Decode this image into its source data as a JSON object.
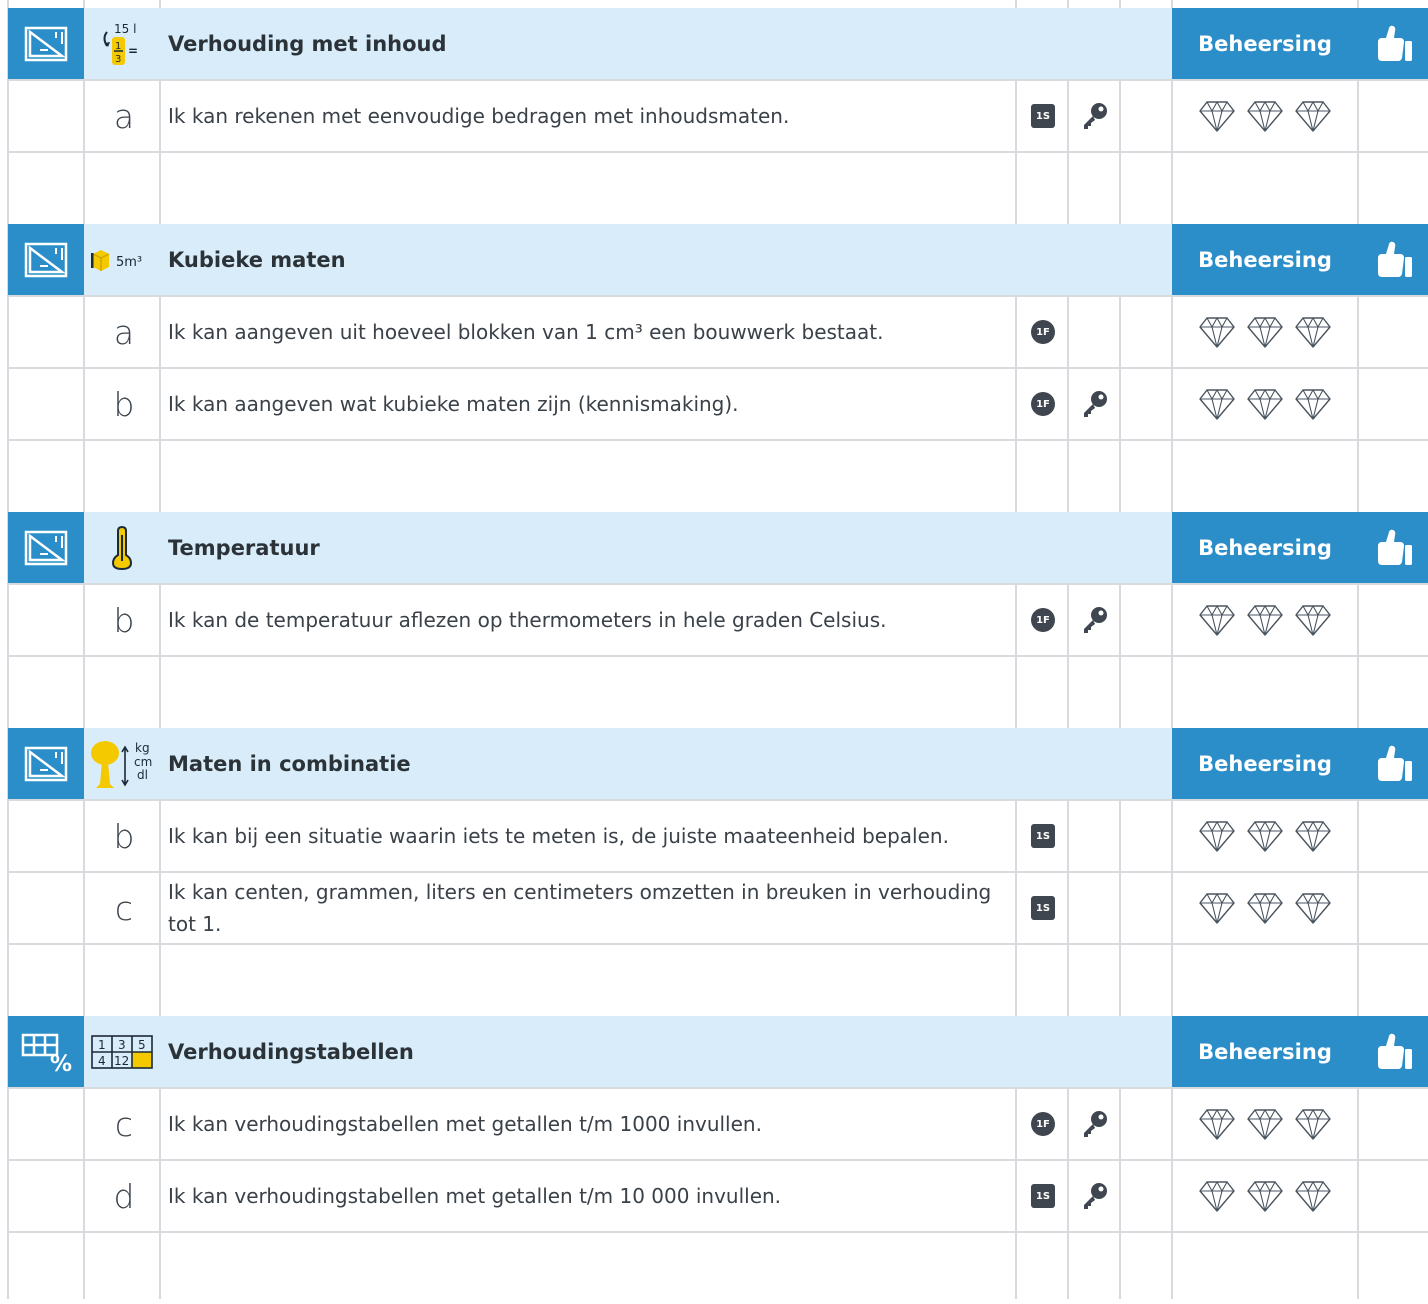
{
  "sections": [
    {
      "title": "Verhouding met inhoud",
      "domain_icon": "ruler-triangle-icon",
      "topic_icon": "fraction-volume-icon",
      "topic_icon_text": [
        "15 l",
        "1",
        "3",
        "="
      ],
      "mastery_label": "Beheersing",
      "mastery_icon": "thumbs-up-icon",
      "goals": [
        {
          "letter": "a",
          "text": "Ik kan rekenen met eenvoudige bedragen met inhoudsmaten.",
          "level": "1S",
          "key": true,
          "rating_icons": [
            "diamond-icon",
            "diamond-icon",
            "diamond-icon"
          ]
        }
      ]
    },
    {
      "title": "Kubieke maten",
      "domain_icon": "ruler-triangle-icon",
      "topic_icon": "cube-icon",
      "topic_icon_text": [
        "5m³"
      ],
      "mastery_label": "Beheersing",
      "mastery_icon": "thumbs-up-icon",
      "goals": [
        {
          "letter": "a",
          "text": "Ik kan aangeven uit hoeveel blokken van 1 cm³ een bouwwerk bestaat.",
          "level": "1F",
          "key": false,
          "rating_icons": [
            "diamond-icon",
            "diamond-icon",
            "diamond-icon"
          ]
        },
        {
          "letter": "b",
          "text": "Ik kan aangeven wat kubieke maten zijn (kennismaking).",
          "level": "1F",
          "key": true,
          "rating_icons": [
            "diamond-icon",
            "diamond-icon",
            "diamond-icon"
          ]
        }
      ]
    },
    {
      "title": "Temperatuur",
      "domain_icon": "ruler-triangle-icon",
      "topic_icon": "thermometer-icon",
      "topic_icon_text": [],
      "mastery_label": "Beheersing",
      "mastery_icon": "thumbs-up-icon",
      "goals": [
        {
          "letter": "b",
          "text": "Ik kan de temperatuur aflezen op thermometers in hele graden Celsius.",
          "level": "1F",
          "key": true,
          "rating_icons": [
            "diamond-icon",
            "diamond-icon",
            "diamond-icon"
          ]
        }
      ]
    },
    {
      "title": "Maten in combinatie",
      "domain_icon": "ruler-triangle-icon",
      "topic_icon": "tree-units-icon",
      "topic_icon_text": [
        "kg",
        "cm",
        "dl"
      ],
      "mastery_label": "Beheersing",
      "mastery_icon": "thumbs-up-icon",
      "goals": [
        {
          "letter": "b",
          "text": "Ik kan bij een situatie waarin iets te meten is, de juiste maateenheid bepalen.",
          "level": "1S",
          "key": false,
          "rating_icons": [
            "diamond-icon",
            "diamond-icon",
            "diamond-icon"
          ]
        },
        {
          "letter": "c",
          "text": "Ik kan centen, grammen, liters en centimeters omzetten in breuken in verhouding tot 1.",
          "level": "1S",
          "key": false,
          "rating_icons": [
            "diamond-icon",
            "diamond-icon",
            "diamond-icon"
          ]
        }
      ]
    },
    {
      "title": "Verhoudingstabellen",
      "domain_icon": "table-percent-icon",
      "topic_icon": "ratio-table-icon",
      "topic_icon_text": [
        "1",
        "3",
        "5",
        "4",
        "12"
      ],
      "mastery_label": "Beheersing",
      "mastery_icon": "thumbs-up-icon",
      "goals": [
        {
          "letter": "c",
          "text": "Ik kan verhoudingstabellen met getallen t/m 1000 invullen.",
          "level": "1F",
          "key": true,
          "rating_icons": [
            "diamond-icon",
            "diamond-icon",
            "diamond-icon"
          ]
        },
        {
          "letter": "d",
          "text": "Ik kan verhoudingstabellen met getallen t/m 10 000 invullen.",
          "level": "1S",
          "key": true,
          "rating_icons": [
            "diamond-icon",
            "diamond-icon",
            "diamond-icon"
          ]
        }
      ]
    }
  ],
  "colors": {
    "header_bg": "#d8ecfa",
    "accent_blue": "#2b8ec9",
    "grid_line": "#d7dbe0",
    "icon_yellow": "#f5c900",
    "text": "#3a4148"
  }
}
